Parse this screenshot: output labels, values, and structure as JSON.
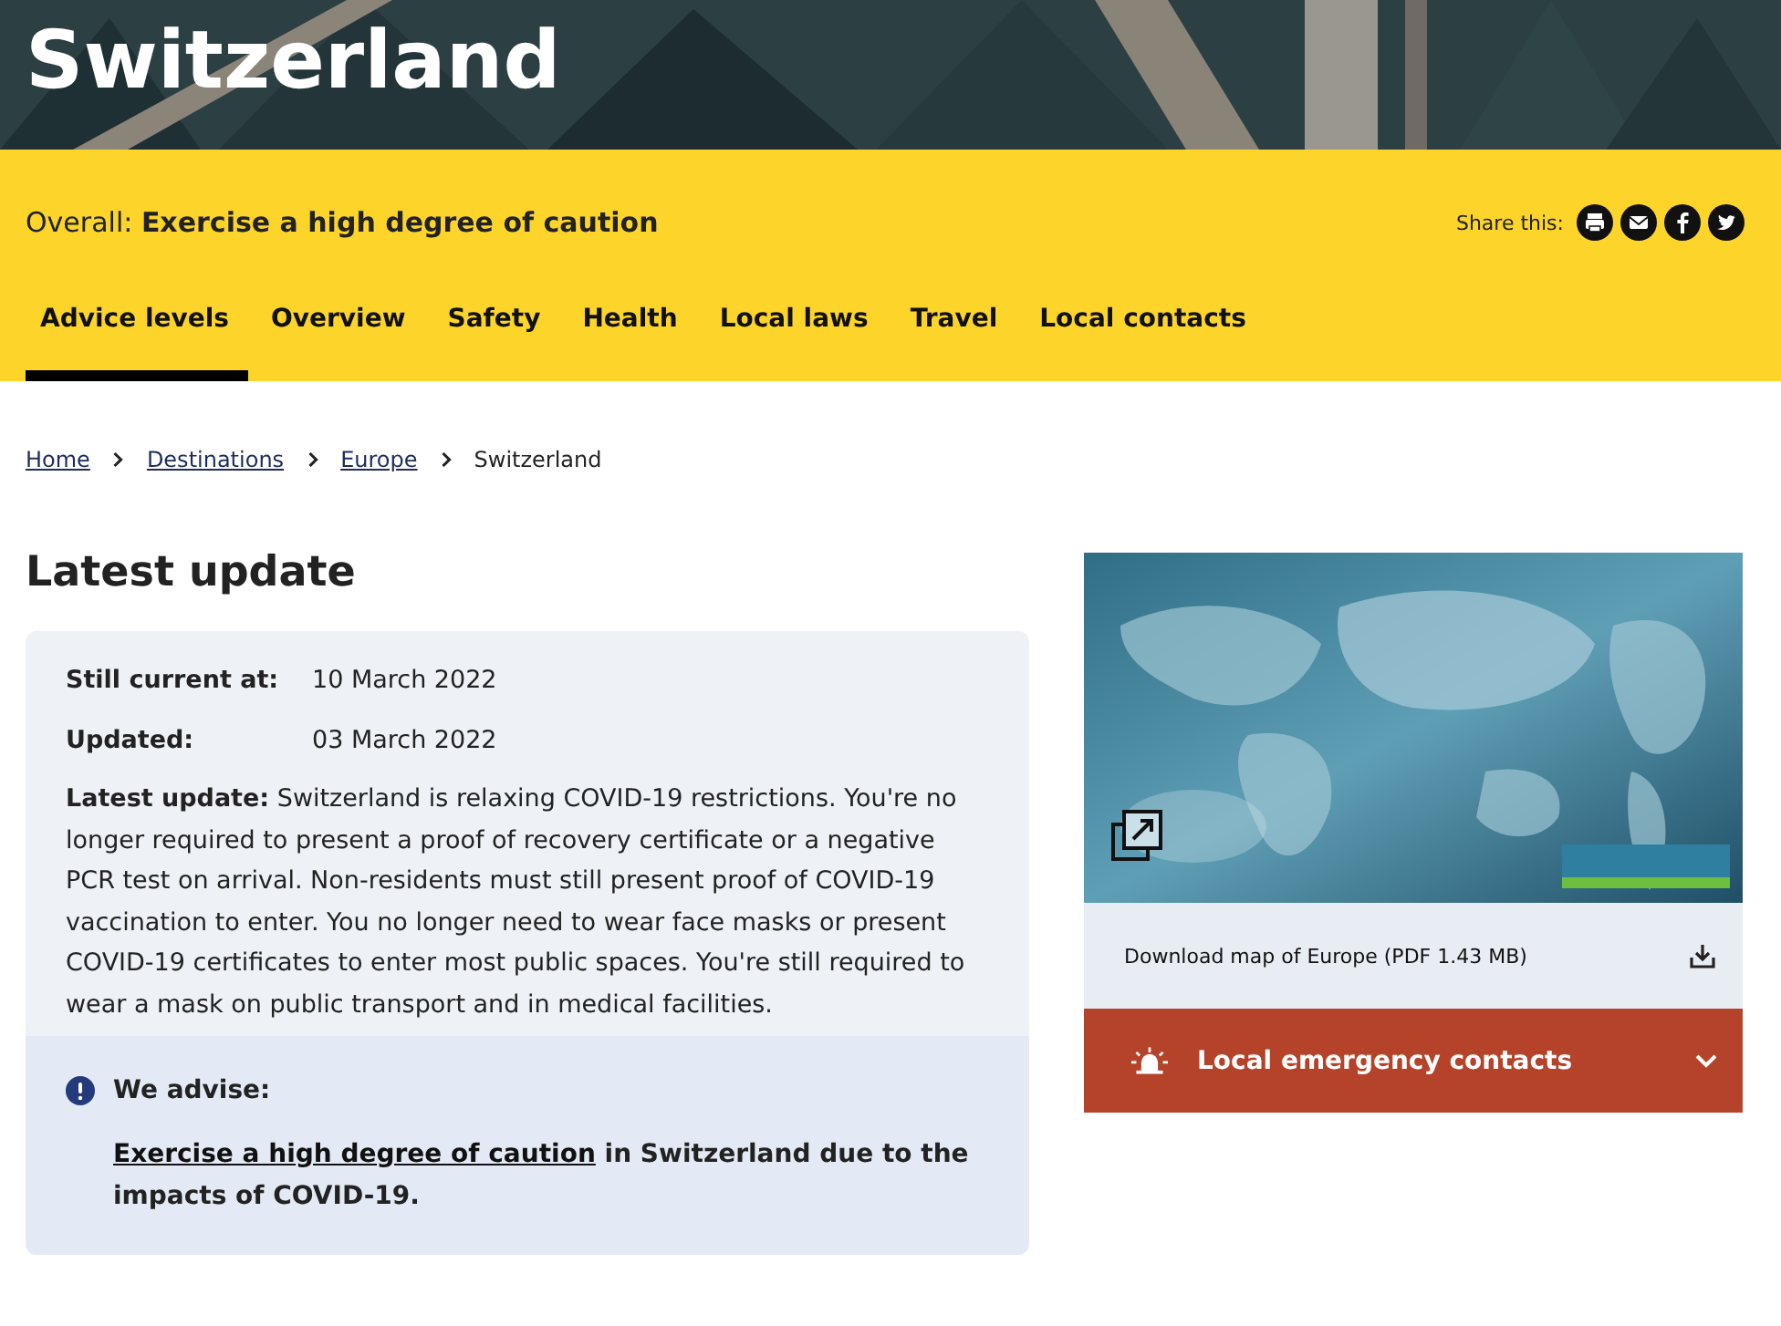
{
  "page_title": "Switzerland",
  "overall": {
    "label": "Overall:",
    "value": "Exercise a high degree of caution"
  },
  "share": {
    "label": "Share this:",
    "icons": [
      {
        "kind": "print"
      },
      {
        "kind": "email"
      },
      {
        "kind": "facebook"
      },
      {
        "kind": "twitter"
      }
    ]
  },
  "tabs": [
    {
      "label": "Advice levels",
      "selected": true
    },
    {
      "label": "Overview",
      "selected": false
    },
    {
      "label": "Safety",
      "selected": false
    },
    {
      "label": "Health",
      "selected": false
    },
    {
      "label": "Local laws",
      "selected": false
    },
    {
      "label": "Travel",
      "selected": false
    },
    {
      "label": "Local contacts",
      "selected": false
    }
  ],
  "breadcrumb": [
    {
      "label": "Home",
      "link": true
    },
    {
      "label": "Destinations",
      "link": true
    },
    {
      "label": "Europe",
      "link": true
    },
    {
      "label": "Switzerland",
      "link": false
    }
  ],
  "latest_update": {
    "heading": "Latest update",
    "rows": [
      {
        "label": "Still current at:",
        "value": "10 March 2022"
      },
      {
        "label": "Updated:",
        "value": "03 March 2022"
      },
      {
        "kind": "paragraph",
        "text": "**Latest update:** Switzerland is relaxing COVID-19 restrictions. You're no longer required to present a proof of recovery certificate or a negative PCR test on arrival. Non-residents must still present proof of COVID-19 vaccination to enter. You no longer need to wear face masks or present COVID-19 certificates to enter most public spaces. You're still required to wear a mask on public transport and in medical facilities."
      }
    ],
    "advise": {
      "heading": "We advise:",
      "link": "Exercise a high degree of caution",
      "text": "in Switzerland due to the impacts of COVID-19."
    }
  },
  "map": {
    "kind": "picture",
    "download": "Download map of Europe (PDF 1.43 MB)"
  },
  "emergency": {
    "label": "Local emergency contacts",
    "expanded": false
  }
}
